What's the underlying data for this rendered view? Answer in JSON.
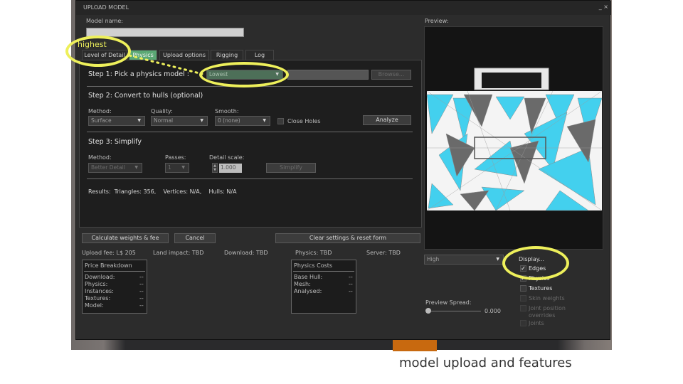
{
  "window": {
    "title": "UPLOAD MODEL",
    "controls": "_ ×"
  },
  "model_name": {
    "label": "Model name:",
    "value": ""
  },
  "tabs": [
    "Level of Detail",
    "Physics",
    "Upload options",
    "Rigging",
    "Log"
  ],
  "active_tab": "Physics",
  "step1": {
    "title": "Step 1: Pick a physics model :",
    "selected": "Lowest",
    "browse": "Browse..."
  },
  "step2": {
    "title": "Step 2: Convert to hulls (optional)",
    "method_label": "Method:",
    "method": "Surface",
    "quality_label": "Quality:",
    "quality": "Normal",
    "smooth_label": "Smooth:",
    "smooth": "0 (none)",
    "close_holes": "Close Holes",
    "analyze": "Analyze"
  },
  "step3": {
    "title": "Step 3: Simplify",
    "method_label": "Method:",
    "method": "Better Detail",
    "passes_label": "Passes:",
    "passes": "1",
    "detail_label": "Detail scale:",
    "detail": "1.000",
    "simplify": "Simplify"
  },
  "results": "Results:  Triangles: 356,    Vertices: N/A,    Hulls: N/A",
  "buttons": {
    "calc": "Calculate weights & fee",
    "cancel": "Cancel",
    "clear": "Clear settings & reset form"
  },
  "fees": {
    "upload": "Upload fee: L$ 205",
    "land": "Land impact: TBD",
    "download": "Download: TBD",
    "physics": "Physics: TBD",
    "server": "Server: TBD"
  },
  "price_breakdown": {
    "title": "Price Breakdown",
    "rows": [
      [
        "Download:",
        "--"
      ],
      [
        "Physics:",
        "--"
      ],
      [
        "Instances:",
        "--"
      ],
      [
        "Textures:",
        "--"
      ],
      [
        "Model:",
        "--"
      ]
    ]
  },
  "physics_costs": {
    "title": "Physics Costs",
    "rows": [
      [
        "Base Hull:",
        "--"
      ],
      [
        "Mesh:",
        "--"
      ],
      [
        "Analysed:",
        "--"
      ]
    ]
  },
  "preview": {
    "label": "Preview:",
    "lod": "High",
    "spread_label": "Preview Spread:",
    "spread_value": "0.000",
    "display_label": "Display...",
    "options": [
      {
        "label": "Edges",
        "checked": true,
        "enabled": true
      },
      {
        "label": "Physics",
        "checked": true,
        "enabled": true
      },
      {
        "label": "Textures",
        "checked": false,
        "enabled": true
      },
      {
        "label": "Skin weights",
        "checked": false,
        "enabled": false
      },
      {
        "label": "Joint position overrides",
        "checked": false,
        "enabled": false
      },
      {
        "label": "Joints",
        "checked": false,
        "enabled": false
      }
    ]
  },
  "annotation": {
    "highest": "highest",
    "caption": "model upload and features"
  },
  "colors": {
    "accent": "#5aa874",
    "highlight": "#eef05b",
    "mesh_blue": "#43d0ee"
  }
}
